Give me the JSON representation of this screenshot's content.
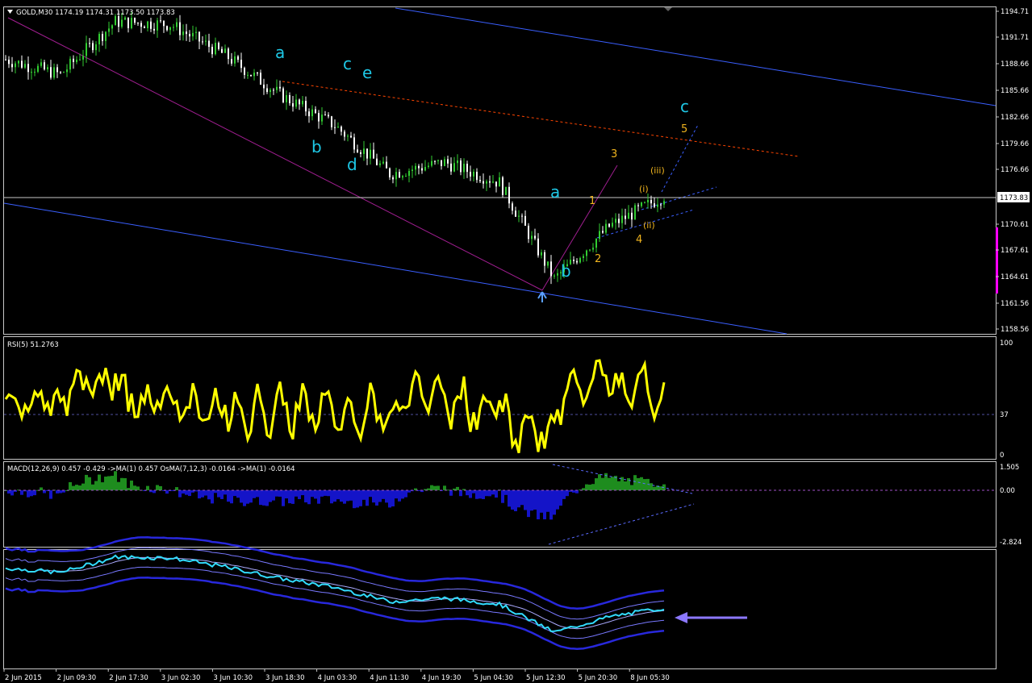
{
  "colors": {
    "background": "#000000",
    "frame": "#c8c8c8",
    "bull_candle": "#32cd32",
    "bear_candle": "#ffffff",
    "channel": "#3a5fff",
    "diagonal": "#a01e90",
    "resistance": "#ff4500",
    "wave_label_primary": "#1ec8e6",
    "wave_label_minor": "#f0b41e",
    "rsi_line": "#ffff00",
    "macd_positive": "#1e8c1e",
    "macd_histogram": "#1414c8",
    "indicator_line": "#32dcff",
    "bands": "#2828dc",
    "arrow": "#8c78ff",
    "price_marker": "#ff00ff"
  },
  "header": {
    "menu_icon": "triangle-down-icon",
    "symbol_info": "GOLD,M30  1174.19 1174.31 1173.50 1173.83"
  },
  "price_axis": {
    "ticks": [
      "1194.71",
      "1191.71",
      "1188.66",
      "1185.66",
      "1182.66",
      "1179.66",
      "1176.66",
      "1173.83",
      "1170.61",
      "1167.61",
      "1164.61",
      "1161.56",
      "1158.56"
    ],
    "current_price": "1173.83"
  },
  "time_axis": {
    "ticks": [
      "2 Jun 2015",
      "2 Jun 09:30",
      "2 Jun 17:30",
      "3 Jun 02:30",
      "3 Jun 10:30",
      "3 Jun 18:30",
      "4 Jun 03:30",
      "4 Jun 11:30",
      "4 Jun 19:30",
      "5 Jun 04:30",
      "5 Jun 12:30",
      "5 Jun 20:30",
      "8 Jun 05:30"
    ]
  },
  "wave_labels": {
    "primary": [
      "a",
      "b",
      "c",
      "e",
      "d",
      "a",
      "b",
      "c"
    ],
    "minor": [
      "1",
      "2",
      "3",
      "4",
      "5",
      "(i)",
      "(ii)",
      "(iii)"
    ]
  },
  "rsi": {
    "title": "RSI(5) 51.2763",
    "scale": [
      "100",
      "37",
      "0"
    ]
  },
  "macd": {
    "title": "MACD(12,26,9) 0.457 -0.429 ->MA(1) 0.457  OsMA(7,12,3) -0.0164 ->MA(1) -0.0164",
    "scale": [
      "1.505",
      "0.00",
      "-2.824"
    ]
  },
  "chart_data": {
    "type": "line",
    "title": "GOLD,M30",
    "ohlc_last": {
      "open": 1174.19,
      "high": 1174.31,
      "low": 1173.5,
      "close": 1173.83
    },
    "ylim": [
      1158.56,
      1194.71
    ],
    "x": [
      "2 Jun 2015",
      "2 Jun 09:30",
      "2 Jun 17:30",
      "3 Jun 02:30",
      "3 Jun 10:30",
      "3 Jun 18:30",
      "4 Jun 03:30",
      "4 Jun 11:30",
      "4 Jun 19:30",
      "5 Jun 04:30",
      "5 Jun 12:30",
      "5 Jun 20:30",
      "8 Jun 05:30"
    ],
    "series": [
      {
        "values": [
          1189.5,
          1187.8,
          1193.8,
          1193.5,
          1190.0,
          1185.5,
          1182.0,
          1176.5,
          1177.8,
          1175.5,
          1164.5,
          1170.5,
          1174.0
        ]
      }
    ]
  }
}
